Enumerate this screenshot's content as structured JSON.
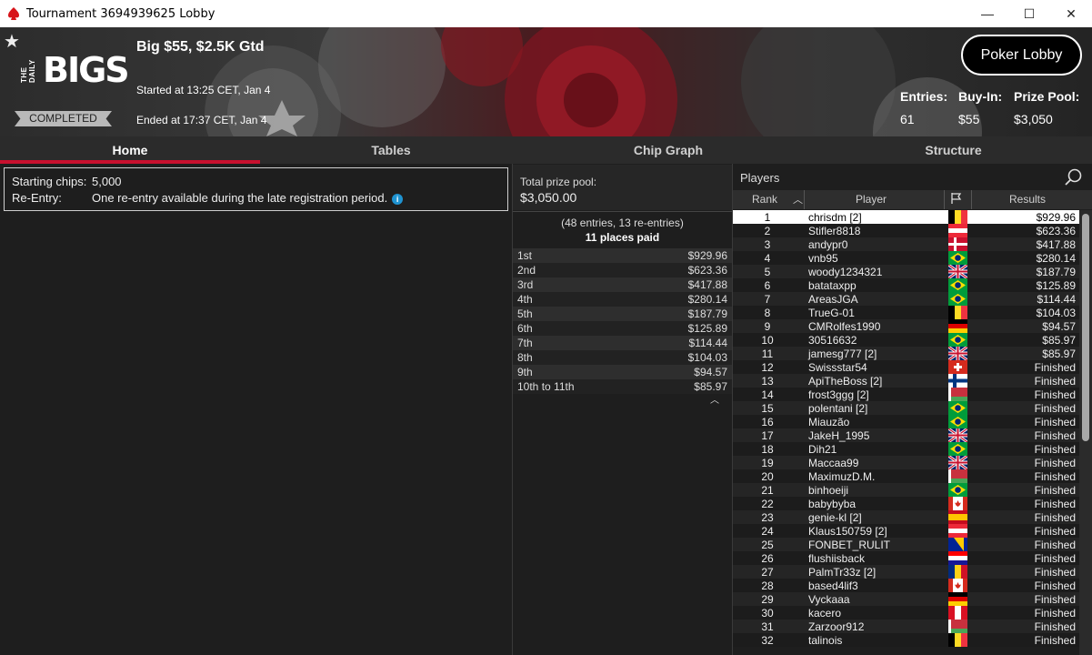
{
  "window": {
    "title": "Tournament 3694939625 Lobby",
    "minimize": "—",
    "maximize": "☐",
    "close": "✕"
  },
  "banner": {
    "logo_small": "THE DAILY",
    "logo_big": "BIGS",
    "status": "COMPLETED",
    "tournament_name": "Big $55, $2.5K Gtd",
    "started": "Started at 13:25 CET, Jan 4",
    "ended": "Ended at 17:37 CET, Jan 4",
    "lobby_button": "Poker Lobby",
    "entries_label": "Entries:",
    "entries_value": "61",
    "buyin_label": "Buy-In:",
    "buyin_value": "$55",
    "prizepool_label": "Prize Pool:",
    "prizepool_value": "$3,050"
  },
  "tabs": [
    "Home",
    "Tables",
    "Chip Graph",
    "Structure"
  ],
  "home": {
    "starting_chips_label": "Starting chips:",
    "starting_chips_value": "5,000",
    "reentry_label": "Re-Entry:",
    "reentry_value": "One re-entry available during the late registration period."
  },
  "prize": {
    "total_label": "Total prize pool:",
    "total_value": "$3,050.00",
    "entries_note": "(48 entries, 13 re-entries)",
    "places_paid": "11 places paid",
    "rows": [
      {
        "place": "1st",
        "amount": "$929.96"
      },
      {
        "place": "2nd",
        "amount": "$623.36"
      },
      {
        "place": "3rd",
        "amount": "$417.88"
      },
      {
        "place": "4th",
        "amount": "$280.14"
      },
      {
        "place": "5th",
        "amount": "$187.79"
      },
      {
        "place": "6th",
        "amount": "$125.89"
      },
      {
        "place": "7th",
        "amount": "$114.44"
      },
      {
        "place": "8th",
        "amount": "$104.03"
      },
      {
        "place": "9th",
        "amount": "$94.57"
      },
      {
        "place": "10th to 11th",
        "amount": "$85.97"
      }
    ]
  },
  "players": {
    "title": "Players",
    "col_rank": "Rank",
    "col_player": "Player",
    "col_results": "Results",
    "rows": [
      {
        "rank": "1",
        "name": "chrisdm [2]",
        "flag": "be",
        "result": "$929.96"
      },
      {
        "rank": "2",
        "name": "Stifler8818",
        "flag": "at",
        "result": "$623.36"
      },
      {
        "rank": "3",
        "name": "andypr0",
        "flag": "dk",
        "result": "$417.88"
      },
      {
        "rank": "4",
        "name": "vnb95",
        "flag": "br",
        "result": "$280.14"
      },
      {
        "rank": "5",
        "name": "woody1234321",
        "flag": "gb",
        "result": "$187.79"
      },
      {
        "rank": "6",
        "name": "batataxpp",
        "flag": "br",
        "result": "$125.89"
      },
      {
        "rank": "7",
        "name": "AreasJGA",
        "flag": "br",
        "result": "$114.44"
      },
      {
        "rank": "8",
        "name": "TrueG-01",
        "flag": "be",
        "result": "$104.03"
      },
      {
        "rank": "9",
        "name": "CMRolfes1990",
        "flag": "de",
        "result": "$94.57"
      },
      {
        "rank": "10",
        "name": "30516632",
        "flag": "br",
        "result": "$85.97"
      },
      {
        "rank": "11",
        "name": "jamesg777 [2]",
        "flag": "gb",
        "result": "$85.97"
      },
      {
        "rank": "12",
        "name": "Swissstar54",
        "flag": "ch",
        "result": "Finished"
      },
      {
        "rank": "13",
        "name": "ApiTheBoss [2]",
        "flag": "fi",
        "result": "Finished"
      },
      {
        "rank": "14",
        "name": "frost3ggg [2]",
        "flag": "by",
        "result": "Finished"
      },
      {
        "rank": "15",
        "name": "polentani [2]",
        "flag": "br",
        "result": "Finished"
      },
      {
        "rank": "16",
        "name": "Miauzão",
        "flag": "br",
        "result": "Finished"
      },
      {
        "rank": "17",
        "name": "JakeH_1995",
        "flag": "gb",
        "result": "Finished"
      },
      {
        "rank": "18",
        "name": "Dih21",
        "flag": "br",
        "result": "Finished"
      },
      {
        "rank": "19",
        "name": "Maccaa99",
        "flag": "gb",
        "result": "Finished"
      },
      {
        "rank": "20",
        "name": "MaximuzD.M.",
        "flag": "by",
        "result": "Finished"
      },
      {
        "rank": "21",
        "name": "binhoeiji",
        "flag": "br",
        "result": "Finished"
      },
      {
        "rank": "22",
        "name": "babybyba",
        "flag": "ca",
        "result": "Finished"
      },
      {
        "rank": "23",
        "name": "genie-kl [2]",
        "flag": "es",
        "result": "Finished"
      },
      {
        "rank": "24",
        "name": "Klaus150759 [2]",
        "flag": "at",
        "result": "Finished"
      },
      {
        "rank": "25",
        "name": "FONBET_RULIT",
        "flag": "ba",
        "result": "Finished"
      },
      {
        "rank": "26",
        "name": "flushiisback",
        "flag": "hr",
        "result": "Finished"
      },
      {
        "rank": "27",
        "name": "PalmTr33z [2]",
        "flag": "ro",
        "result": "Finished"
      },
      {
        "rank": "28",
        "name": "based4lif3",
        "flag": "ca",
        "result": "Finished"
      },
      {
        "rank": "29",
        "name": "Vyckaaa",
        "flag": "de",
        "result": "Finished"
      },
      {
        "rank": "30",
        "name": "kacero",
        "flag": "pe",
        "result": "Finished"
      },
      {
        "rank": "31",
        "name": "Zarzoor912",
        "flag": "by",
        "result": "Finished"
      },
      {
        "rank": "32",
        "name": "talinois",
        "flag": "be",
        "result": "Finished"
      }
    ]
  },
  "colors": {
    "accent_red": "#c8102e",
    "info_blue": "#1f93d1",
    "background": "#1e1e1e"
  }
}
